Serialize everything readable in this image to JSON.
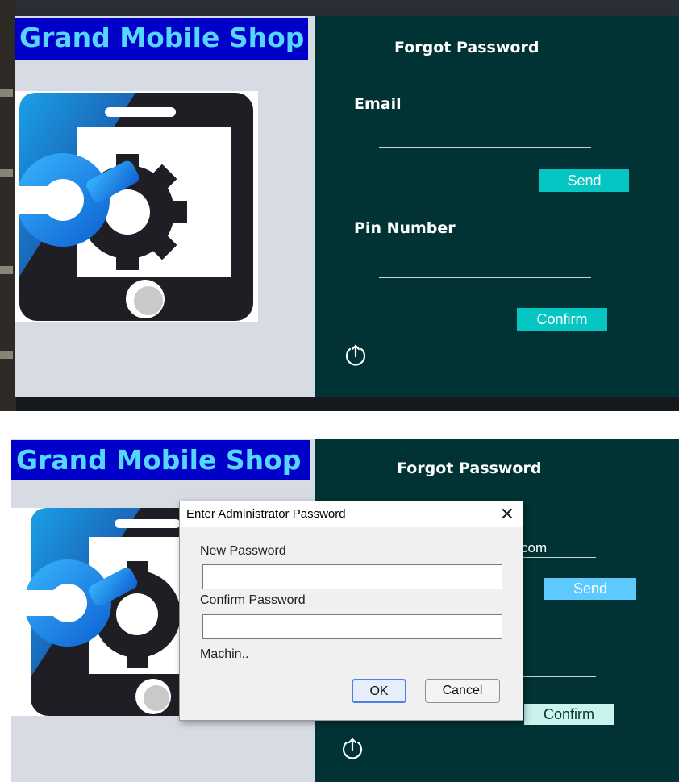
{
  "top": {
    "brand_title": "Grand Mobile Shop",
    "form_title": "Forgot Password",
    "email_label": "Email",
    "send_label": "Send",
    "pin_label": "Pin Number",
    "confirm_label": "Confirm",
    "power_icon": "power-icon"
  },
  "bottom": {
    "brand_title": "Grand Mobile Shop",
    "form_title": "Forgot Password",
    "email_partial": "com",
    "send_label": "Send",
    "confirm_label": "Confirm",
    "power_icon": "power-icon"
  },
  "dialog": {
    "title": "Enter Administrator Password",
    "close_icon": "close-icon",
    "new_password_label": "New Password",
    "new_password_value": "",
    "confirm_password_label": "Confirm Password",
    "confirm_password_value": "",
    "machine_label": "Machin..",
    "ok_label": "OK",
    "cancel_label": "Cancel"
  },
  "colors": {
    "dark_teal": "#013334",
    "brand_blue": "#0000c8",
    "brand_text": "#55d6ff",
    "panel_gray": "#d7dbe3",
    "button_teal": "#06c6c4",
    "button_sky": "#5ec9ff"
  }
}
